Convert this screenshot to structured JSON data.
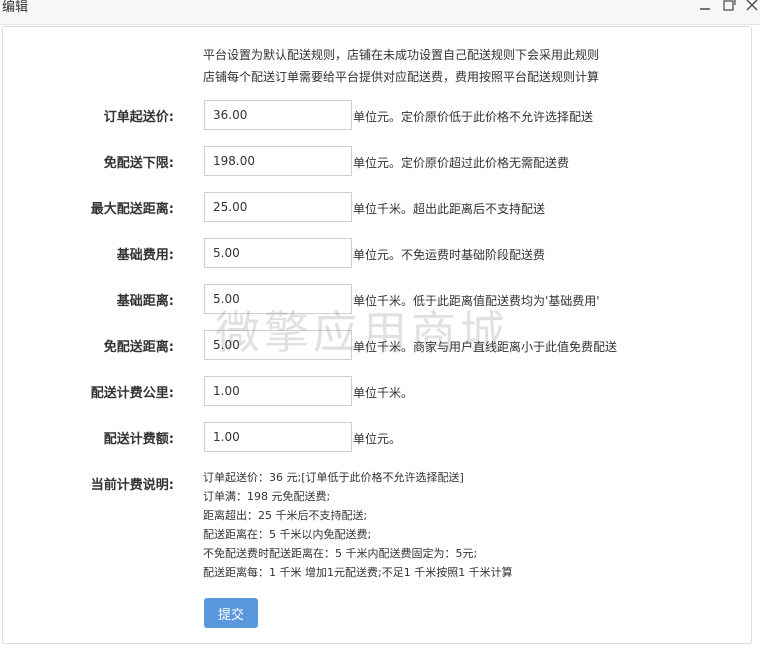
{
  "window": {
    "title": "编辑",
    "minimize_icon": "minimize-icon",
    "maximize_icon": "maximize-icon",
    "close_icon": "close-icon"
  },
  "notice": {
    "line1": "平台设置为默认配送规则，店铺在未成功设置自己配送规则下会采用此规则",
    "line2": "店铺每个配送订单需要给平台提供对应配送费，费用按照平台配送规则计算"
  },
  "fields": [
    {
      "label": "订单起送价:",
      "value": "36.00",
      "hint": "单位元。定价原价低于此价格不允许选择配送"
    },
    {
      "label": "免配送下限:",
      "value": "198.00",
      "hint": "单位元。定价原价超过此价格无需配送费"
    },
    {
      "label": "最大配送距离:",
      "value": "25.00",
      "hint": "单位千米。超出此距离后不支持配送"
    },
    {
      "label": "基础费用:",
      "value": "5.00",
      "hint": "单位元。不免运费时基础阶段配送费"
    },
    {
      "label": "基础距离:",
      "value": "5.00",
      "hint": "单位千米。低于此距离值配送费均为'基础费用'"
    },
    {
      "label": "免配送距离:",
      "value": "5.00",
      "hint": "单位千米。商家与用户直线距离小于此值免费配送"
    },
    {
      "label": "配送计费公里:",
      "value": "1.00",
      "hint": "单位千米。"
    },
    {
      "label": "配送计费额:",
      "value": "1.00",
      "hint": "单位元。"
    }
  ],
  "description": {
    "label": "当前计费说明:",
    "lines": [
      "订单起送价：36 元;[订单低于此价格不允许选择配送]",
      "订单满：198 元免配送费;",
      "距离超出：25 千米后不支持配送;",
      "配送距离在：5 千米以内免配送费;",
      "不免配送费时配送距离在：5 千米内配送费固定为：5元;",
      "配送距离每：1 千米 增加1元配送费;不足1 千米按照1 千米计算"
    ]
  },
  "watermark": "微擎应用商城",
  "submit_label": "提交",
  "colors": {
    "primary": "#5a98de"
  }
}
